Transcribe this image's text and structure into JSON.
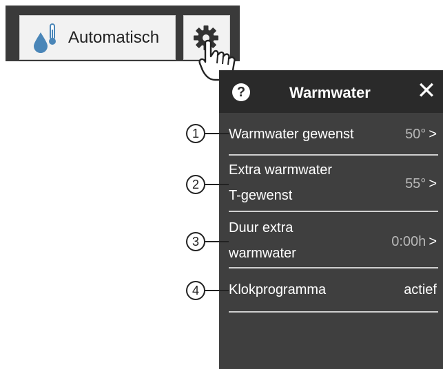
{
  "toolbar": {
    "mode_label": "Automatisch",
    "mode_icon": "water-temperature-icon",
    "settings_icon": "gear-icon",
    "cursor_icon": "hand-pointer-icon"
  },
  "panel": {
    "help_icon": "?",
    "title": "Warmwater",
    "close_icon": "✕",
    "rows": [
      {
        "callout": "1",
        "label_lines": [
          "Warmwater gewenst"
        ],
        "value": "50°",
        "chevron": ">"
      },
      {
        "callout": "2",
        "label_lines": [
          "Extra warmwater",
          "T-gewenst"
        ],
        "value": "55°",
        "chevron": ">"
      },
      {
        "callout": "3",
        "label_lines": [
          "Duur extra",
          "warmwater"
        ],
        "value": "0:00h",
        "chevron": ">"
      },
      {
        "callout": "4",
        "label_lines": [
          "Klokprogramma"
        ],
        "value": "actief",
        "chevron": ""
      }
    ]
  },
  "colors": {
    "toolbar_bg": "#3a3a3a",
    "panel_bg": "#3f3f3f",
    "header_bg": "#2a2a2a",
    "value_gray": "#b8b8b8",
    "drop_blue": "#4a86b8"
  }
}
